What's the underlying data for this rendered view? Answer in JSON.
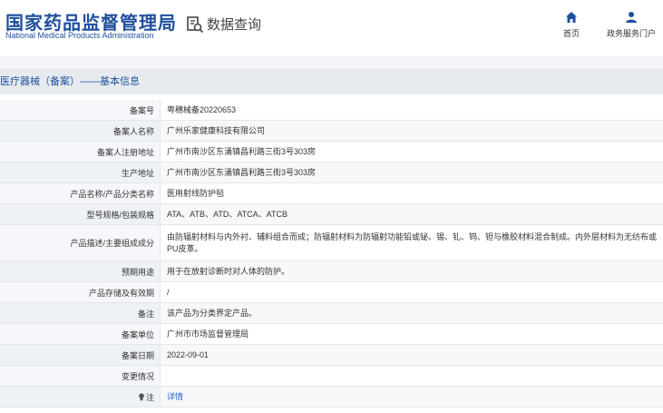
{
  "header": {
    "logo_cn": "国家药品监督管理局",
    "logo_en": "National Medical Products Administration",
    "query_label": "数据查询",
    "nav": [
      {
        "label": "首页",
        "icon": "home-icon"
      },
      {
        "label": "政务服务门户",
        "icon": "user-icon"
      }
    ]
  },
  "section": {
    "title": "医疗器械（备案）——基本信息"
  },
  "rows": [
    {
      "key": "备案号",
      "value": "粤穗械备20220653"
    },
    {
      "key": "备案人名称",
      "value": "广州乐家健康科技有限公司"
    },
    {
      "key": "备案人注册地址",
      "value": "广州市南沙区东涌镇昌利路三街3号303房"
    },
    {
      "key": "生产地址",
      "value": "广州市南沙区东涌镇昌利路三街3号303房"
    },
    {
      "key": "产品名称/产品分类名称",
      "value": "医用射线防护毡"
    },
    {
      "key": "型号规格/包装规格",
      "value": "ATA、ATB、ATD、ATCA、ATCB"
    },
    {
      "key": "产品描述/主要组成成分",
      "value": "由防辐射材料与内外衬、辅料组合而成；防辐射材料为防辐射功能铅或铋、锡、钆、钨、钽与橡胶材料混合制成。内外层材料为无纺布或PU皮革。"
    },
    {
      "key": "预期用途",
      "value": "用于在放射诊断时对人体的防护。"
    },
    {
      "key": "产品存储及有效期",
      "value": "/"
    },
    {
      "key": "备注",
      "value": "该产品为分类界定产品。"
    },
    {
      "key": "备案单位",
      "value": "广州市市场监督管理局"
    },
    {
      "key": "备案日期",
      "value": "2022-09-01"
    },
    {
      "key": "变更情况",
      "value": ""
    },
    {
      "key": "注",
      "value": "详情"
    }
  ],
  "colors": {
    "brand": "#1f4f9e",
    "link": "#1f62c9"
  }
}
